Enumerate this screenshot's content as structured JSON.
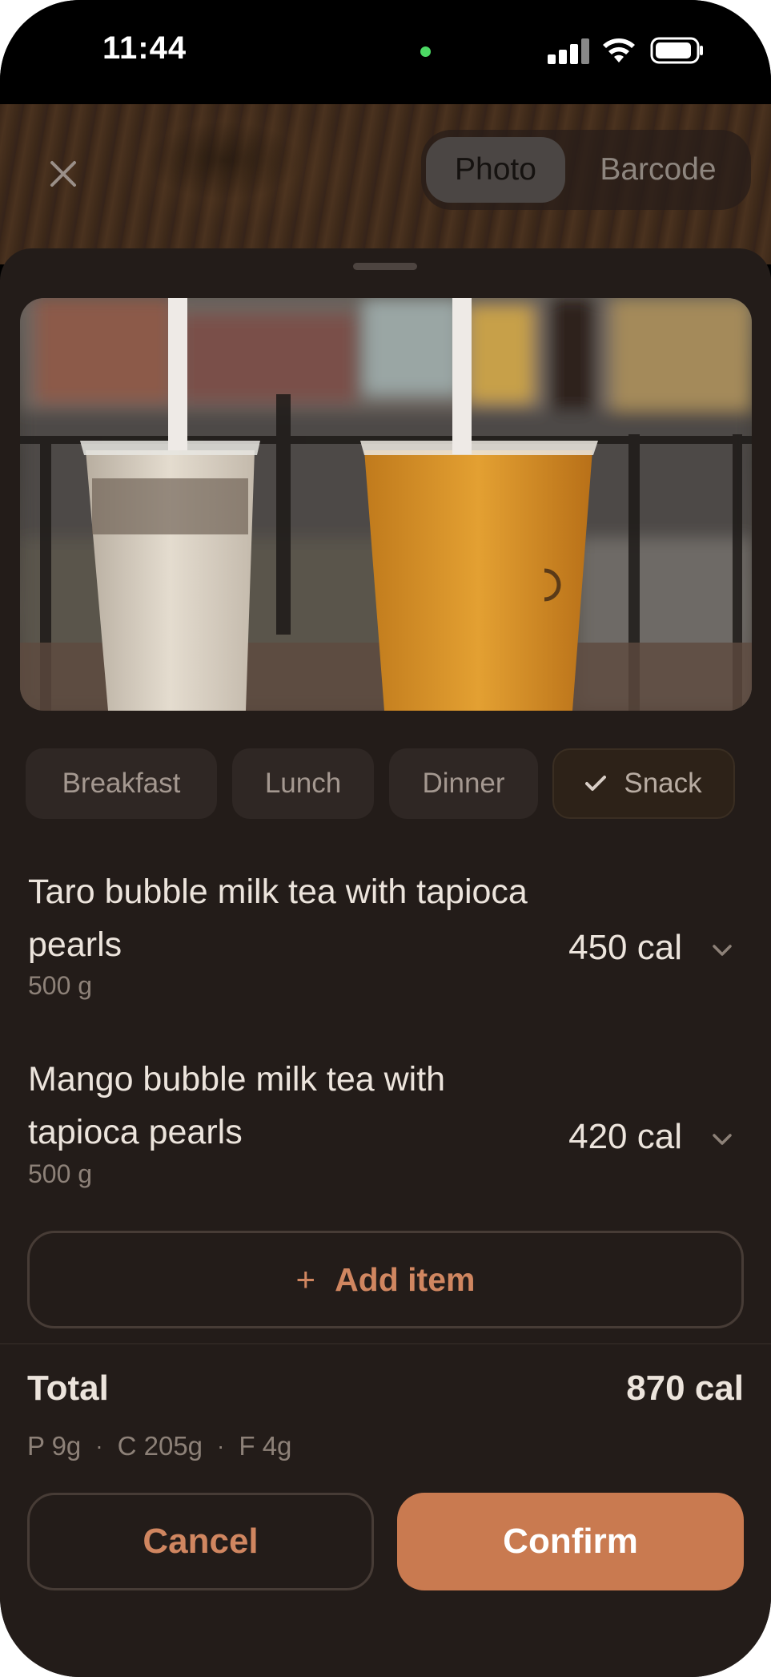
{
  "status_bar": {
    "time": "11:44"
  },
  "top_bar": {
    "close_icon": "close-icon",
    "mode_options": [
      "Photo",
      "Barcode"
    ],
    "selected_mode": "Photo"
  },
  "meals": [
    {
      "label": "Breakfast",
      "selected": false
    },
    {
      "label": "Lunch",
      "selected": false
    },
    {
      "label": "Dinner",
      "selected": false
    },
    {
      "label": "Snack",
      "selected": true
    }
  ],
  "items": [
    {
      "name": "Taro bubble milk tea with tapioca pearls",
      "weight": "500 g",
      "calories": "450 cal"
    },
    {
      "name": "Mango bubble milk tea with tapioca pearls",
      "weight": "500 g",
      "calories": "420 cal"
    }
  ],
  "add_item": {
    "label": "Add item",
    "icon": "+"
  },
  "total": {
    "label": "Total",
    "calories": "870 cal",
    "protein": "P 9g",
    "carbs": "C 205g",
    "fat": "F 4g",
    "separator": "·"
  },
  "actions": {
    "cancel": "Cancel",
    "confirm": "Confirm"
  },
  "colors": {
    "accent": "#c97a50",
    "sheet_background": "#231c19",
    "text_primary": "#ece4dc",
    "text_secondary": "#8d8178"
  }
}
